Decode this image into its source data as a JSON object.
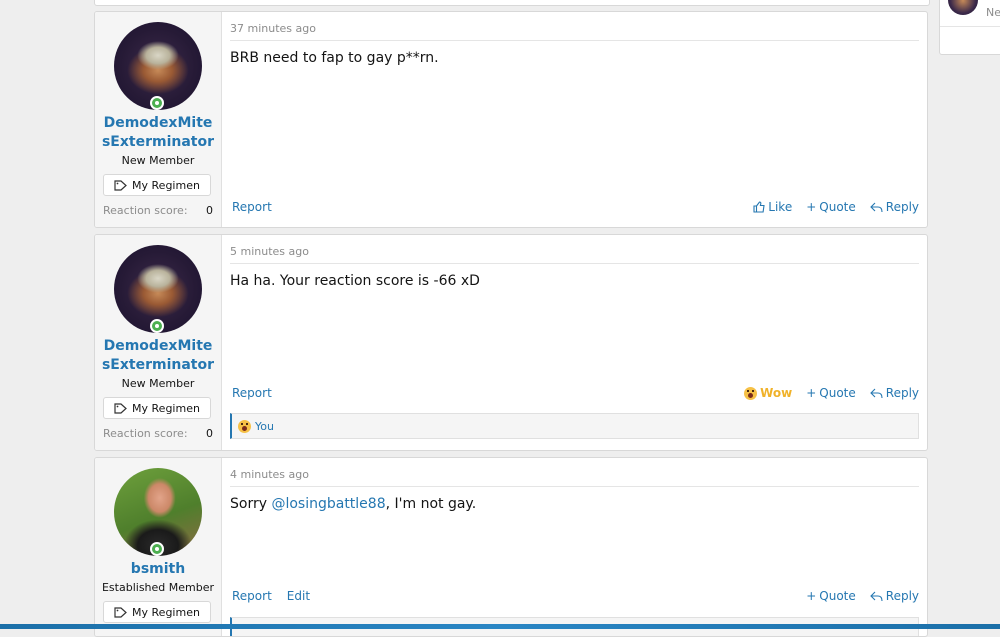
{
  "colors": {
    "link": "#2577b1",
    "wow": "#f0b22a",
    "online": "#4caf50"
  },
  "posts": [
    {
      "date": "37 minutes ago",
      "username": "DemodexMitesExterminator",
      "user_title": "New Member",
      "regimen_label": "My Regimen",
      "reaction_score_label": "Reaction score:",
      "reaction_score_value": "0",
      "body": "BRB need to fap to gay p**rn.",
      "report_label": "Report",
      "like_label": "Like",
      "quote_label": "Quote",
      "reply_label": "Reply",
      "avatar_icon": "dust-mite-avatar"
    },
    {
      "date": "5 minutes ago",
      "username": "DemodexMitesExterminator",
      "user_title": "New Member",
      "regimen_label": "My Regimen",
      "reaction_score_label": "Reaction score:",
      "reaction_score_value": "0",
      "body": "Ha ha. Your reaction score is -66 xD",
      "report_label": "Report",
      "reaction_label": "Wow",
      "quote_label": "Quote",
      "reply_label": "Reply",
      "reactions_summary": "You",
      "avatar_icon": "dust-mite-avatar"
    },
    {
      "date": "4 minutes ago",
      "username": "bsmith",
      "user_title": "Established Member",
      "regimen_label": "My Regimen",
      "body_before": "Sorry ",
      "mention": "@losingbattle88",
      "body_after": ", I'm not gay.",
      "report_label": "Report",
      "edit_label": "Edit",
      "quote_label": "Quote",
      "reply_label": "Reply",
      "avatar_icon": "person-photo-avatar"
    }
  ],
  "sidebar": {
    "text": "Ne"
  }
}
